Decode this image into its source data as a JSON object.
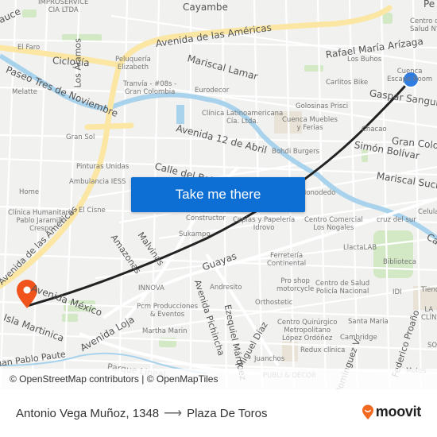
{
  "map": {
    "streets": [
      {
        "text": "Cayambe"
      },
      {
        "text": "Avenida de las Américas"
      },
      {
        "text": "Rafael María Arízaga"
      },
      {
        "text": "Mariscal Lamar"
      },
      {
        "text": "Ciclovía"
      },
      {
        "text": "Paseo Tres de Noviembre"
      },
      {
        "text": "Los Álamos"
      },
      {
        "text": "Gaspar Sangurima"
      },
      {
        "text": "Gran Colombia"
      },
      {
        "text": "Simón Bolívar"
      },
      {
        "text": "Mariscal Sucre"
      },
      {
        "text": "Avenida 12 de Abril"
      },
      {
        "text": "Calle del Batán"
      },
      {
        "text": "Amazonas"
      },
      {
        "text": "Malvinas"
      },
      {
        "text": "Guayas"
      },
      {
        "text": "Avenida México"
      },
      {
        "text": "Isla Martinica"
      },
      {
        "text": "Avenida Loja"
      },
      {
        "text": "Avenida Pichincha"
      },
      {
        "text": "Ezequiel Márquez"
      },
      {
        "text": "Miguel Díaz"
      },
      {
        "text": "Federico Proaño"
      },
      {
        "text": "Avenida de las Américas"
      },
      {
        "text": "Parque Lineal"
      },
      {
        "text": "Juan Pablo Paute"
      },
      {
        "text": "Domínguez V."
      },
      {
        "text": "Sauce"
      },
      {
        "text": "Pe"
      },
      {
        "text": "Ca"
      }
    ],
    "pois": [
      {
        "text": "IMPROSERVICE\nCIA LTDA"
      },
      {
        "text": "El Faro"
      },
      {
        "text": "Peluquería\nElizabeth"
      },
      {
        "text": "Tranvía - #08s -\nGran Colombia"
      },
      {
        "text": "Eurodecor"
      },
      {
        "text": "Melatte"
      },
      {
        "text": "Centro de\nSalud N°"
      },
      {
        "text": "Los Buhos"
      },
      {
        "text": "Carlitos Bike"
      },
      {
        "text": "Cuenca\nEscape Room"
      },
      {
        "text": "Golosinas Prisci"
      },
      {
        "text": "Clínica Latinoamericana\nCía. Ltda."
      },
      {
        "text": "Cuenca Muebles\ny Ferias"
      },
      {
        "text": "Chacao"
      },
      {
        "text": "Bohdi Burgers"
      },
      {
        "text": "Gran Sol"
      },
      {
        "text": "Pinturas Unidas"
      },
      {
        "text": "Ambulancia IESS"
      },
      {
        "text": "Home"
      },
      {
        "text": "El Cisne"
      },
      {
        "text": "Clínica Humanitaria\nPablo Jaramillo\nCrespo"
      },
      {
        "text": "Constructor"
      },
      {
        "text": "Sukampo"
      },
      {
        "text": "Copias y Papelería\nIdrovo"
      },
      {
        "text": "Monodedo"
      },
      {
        "text": "Centro Comercial\nLos Nogales"
      },
      {
        "text": "cruz del sur"
      },
      {
        "text": "Celular"
      },
      {
        "text": "LlactaLAB"
      },
      {
        "text": "Biblioteca"
      },
      {
        "text": "Ferretería\nContinental"
      },
      {
        "text": "Pro shop\nmotorcycle"
      },
      {
        "text": "Centro de Salud\nPolicía Nacional"
      },
      {
        "text": "IDI"
      },
      {
        "text": "Tienda"
      },
      {
        "text": "LA\nCLÍN"
      },
      {
        "text": "INNOVA"
      },
      {
        "text": "Andresito"
      },
      {
        "text": "Orthostetic"
      },
      {
        "text": "Pcm Producciones\n& Eventos"
      },
      {
        "text": "Martha Marin"
      },
      {
        "text": "Centro Quirúrgico\nMetropolitano\nLópez Ordóñez"
      },
      {
        "text": "Santa Maria"
      },
      {
        "text": "Cambridge"
      },
      {
        "text": "Redux clínica"
      },
      {
        "text": "Juanchos"
      },
      {
        "text": "PUBLI & DECOR"
      },
      {
        "text": "Motos"
      },
      {
        "text": "SO"
      }
    ],
    "origin_marker": {
      "icon": "origin-dot-icon",
      "color": "#2f7de1"
    },
    "destination_marker": {
      "icon": "destination-pin-icon",
      "color": "#f0531c"
    },
    "route_color": "#222222",
    "cta_label": "Take me there",
    "attribution": "© OpenStreetMap contributors | © OpenMapTiles"
  },
  "footer": {
    "origin": "Antonio Vega Muñoz, 1348",
    "arrow": "⟶",
    "destination": "Plaza De Toros",
    "logo_text": "moovit",
    "logo_color": "#f26a21"
  },
  "colors": {
    "cta_bg": "#0d6fd4",
    "map_bg": "#f1f1f0",
    "major_road": "#fbe7a3",
    "river": "#a9d3ec",
    "park": "#cfe8c0"
  }
}
